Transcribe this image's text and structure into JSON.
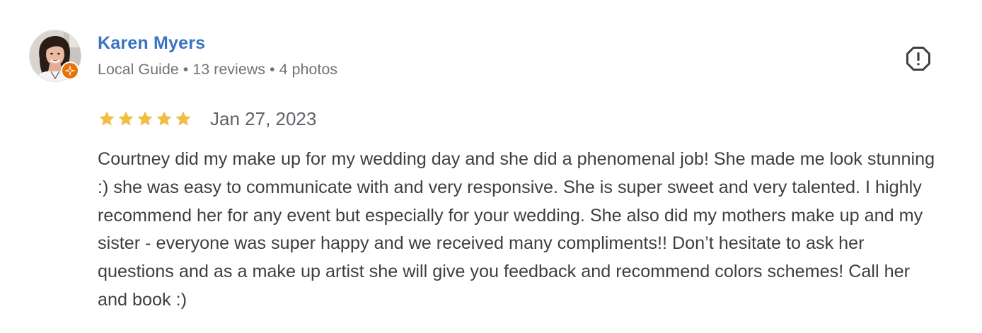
{
  "review": {
    "author": {
      "name": "Karen Myers",
      "badge": "Local Guide",
      "reviews": "13 reviews",
      "photos": "4 photos",
      "separator": "•",
      "avatar_icon": "user-photo",
      "badge_icon": "local-guide-star-icon"
    },
    "rating": {
      "stars": 5,
      "max": 5,
      "star_color": "#f1bd42"
    },
    "date": "Jan 27, 2023",
    "text": "Courtney did my make up for my wedding day and she did a phenomenal job! She made me look stunning :) she was easy to communicate with and very responsive. She is super sweet and very talented. I highly recommend her for any event but especially for your wedding. She also did my mothers make up and my sister - everyone was super happy and we received many compliments!! Don’t hesitate to ask her questions and as a make up artist she will give you feedback and recommend colors schemes! Call her and book :)",
    "flag_icon": "report-icon"
  },
  "colors": {
    "name": "#3b73c4",
    "meta": "#70757a",
    "body": "#3c4043",
    "badge": "#e8710a",
    "star": "#f1bd42"
  }
}
